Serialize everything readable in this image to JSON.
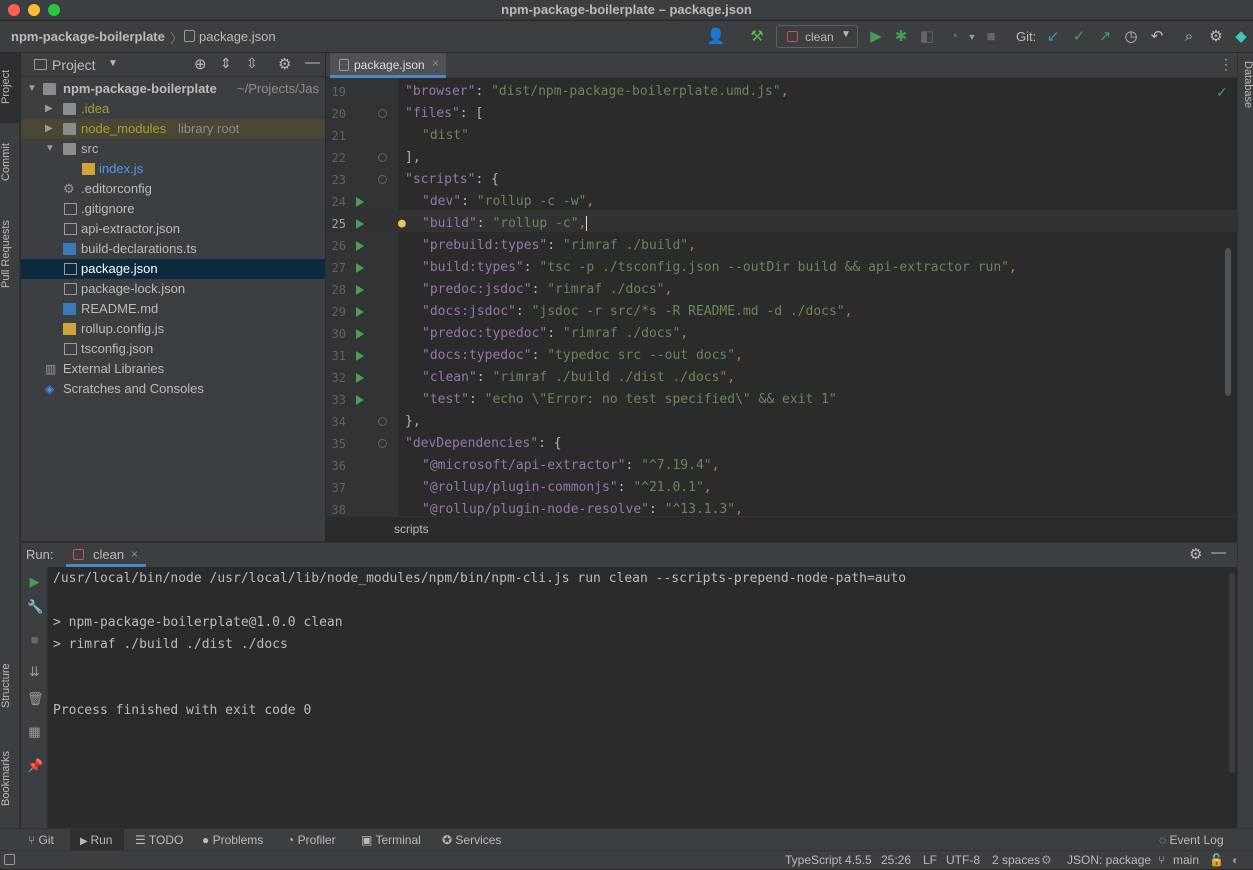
{
  "window": {
    "title": "npm-package-boilerplate – package.json"
  },
  "nav": {
    "project": "npm-package-boilerplate",
    "file": "package.json",
    "run_config": "clean",
    "git_label": "Git:"
  },
  "sidebar_left": {
    "project": "Project",
    "commit": "Commit",
    "pull_requests": "Pull Requests",
    "structure": "Structure",
    "bookmarks": "Bookmarks"
  },
  "sidebar_right": {
    "database": "Database"
  },
  "project_panel": {
    "title": "Project",
    "root": {
      "name": "npm-package-boilerplate",
      "path": "~/Projects/Jas"
    },
    "items": [
      {
        "name": ".idea"
      },
      {
        "name": "node_modules",
        "suffix": "library root"
      },
      {
        "name": "src"
      },
      {
        "name": "index.js"
      },
      {
        "name": ".editorconfig"
      },
      {
        "name": ".gitignore"
      },
      {
        "name": "api-extractor.json"
      },
      {
        "name": "build-declarations.ts"
      },
      {
        "name": "package.json"
      },
      {
        "name": "package-lock.json"
      },
      {
        "name": "README.md"
      },
      {
        "name": "rollup.config.js"
      },
      {
        "name": "tsconfig.json"
      },
      {
        "name": "External Libraries"
      },
      {
        "name": "Scratches and Consoles"
      }
    ]
  },
  "editor": {
    "tab": "package.json",
    "lines": [
      {
        "n": "19",
        "key": "\"browser\"",
        "rest": ": ",
        "val": "\"dist/npm-package-boilerplate.umd.js\"",
        "end": ","
      },
      {
        "n": "20",
        "key": "\"files\"",
        "rest": ": [",
        "val": "",
        "end": ""
      },
      {
        "n": "21",
        "key": "",
        "rest": "",
        "val": "\"dist\"",
        "end": ""
      },
      {
        "n": "22",
        "key": "",
        "rest": "],",
        "val": "",
        "end": ""
      },
      {
        "n": "23",
        "key": "\"scripts\"",
        "rest": ": {",
        "val": "",
        "end": ""
      },
      {
        "n": "24",
        "key": "\"dev\"",
        "rest": ": ",
        "val": "\"rollup -c -w\"",
        "end": ","
      },
      {
        "n": "25",
        "key": "\"build\"",
        "rest": ": ",
        "val": "\"rollup -c\"",
        "end": ","
      },
      {
        "n": "26",
        "key": "\"prebuild:types\"",
        "rest": ": ",
        "val": "\"rimraf ./build\"",
        "end": ","
      },
      {
        "n": "27",
        "key": "\"build:types\"",
        "rest": ": ",
        "val": "\"tsc -p ./tsconfig.json --outDir build && api-extractor run\"",
        "end": ","
      },
      {
        "n": "28",
        "key": "\"predoc:jsdoc\"",
        "rest": ": ",
        "val": "\"rimraf ./docs\"",
        "end": ","
      },
      {
        "n": "29",
        "key": "\"docs:jsdoc\"",
        "rest": ": ",
        "val": "\"jsdoc -r src/*s -R README.md -d ./docs\"",
        "end": ","
      },
      {
        "n": "30",
        "key": "\"predoc:typedoc\"",
        "rest": ": ",
        "val": "\"rimraf ./docs\"",
        "end": ","
      },
      {
        "n": "31",
        "key": "\"docs:typedoc\"",
        "rest": ": ",
        "val": "\"typedoc src --out docs\"",
        "end": ","
      },
      {
        "n": "32",
        "key": "\"clean\"",
        "rest": ": ",
        "val": "\"rimraf ./build ./dist ./docs\"",
        "end": ","
      },
      {
        "n": "33",
        "key": "\"test\"",
        "rest": ": ",
        "val": "\"echo \\\"Error: no test specified\\\" && exit 1\"",
        "end": ""
      },
      {
        "n": "34",
        "key": "",
        "rest": "},",
        "val": "",
        "end": ""
      },
      {
        "n": "35",
        "key": "\"devDependencies\"",
        "rest": ": {",
        "val": "",
        "end": ""
      },
      {
        "n": "36",
        "key": "\"@microsoft/api-extractor\"",
        "rest": ": ",
        "val": "\"^7.19.4\"",
        "end": ","
      },
      {
        "n": "37",
        "key": "\"@rollup/plugin-commonjs\"",
        "rest": ": ",
        "val": "\"^21.0.1\"",
        "end": ","
      },
      {
        "n": "38",
        "key": "\"@rollup/plugin-node-resolve\"",
        "rest": ": ",
        "val": "\"^13.1.3\"",
        "end": ","
      }
    ],
    "breadcrumb": "scripts"
  },
  "run": {
    "label": "Run:",
    "tab": "clean",
    "output": [
      "/usr/local/bin/node /usr/local/lib/node_modules/npm/bin/npm-cli.js run clean --scripts-prepend-node-path=auto",
      "",
      "> npm-package-boilerplate@1.0.0 clean",
      "> rimraf ./build ./dist ./docs",
      "",
      "",
      "Process finished with exit code 0"
    ]
  },
  "toolwindows": {
    "git": "Git",
    "run": "Run",
    "todo": "TODO",
    "problems": "Problems",
    "profiler": "Profiler",
    "terminal": "Terminal",
    "services": "Services",
    "event_log": "Event Log"
  },
  "status": {
    "language": "TypeScript 4.5.5",
    "position": "25:26",
    "line_sep": "LF",
    "encoding": "UTF-8",
    "indent": "2 spaces",
    "schema": "JSON: package",
    "branch": "main"
  }
}
